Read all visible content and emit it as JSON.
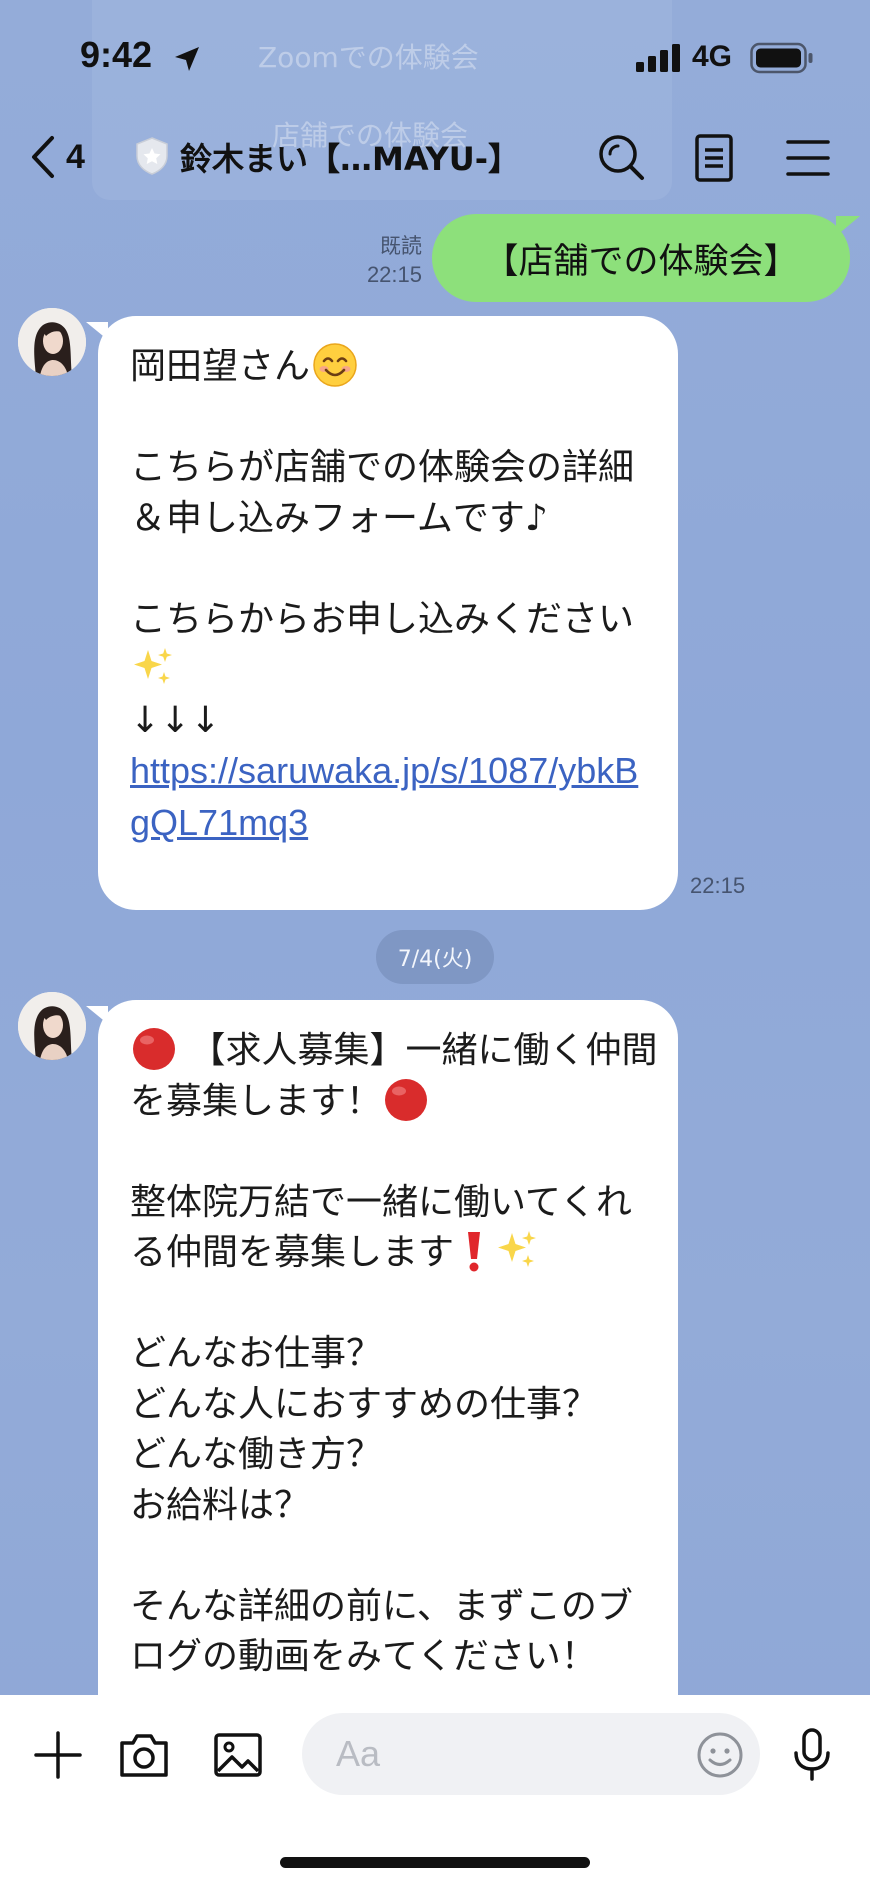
{
  "status_bar": {
    "time": "9:42",
    "network": "4G"
  },
  "ghost_menu": {
    "item1": "Zoomでの体験会",
    "item2": "店舗での体験会"
  },
  "header": {
    "back_count": "4",
    "title": "鈴木まい【…MAYU-】",
    "icons": [
      "chevron-left-icon",
      "shield-icon",
      "search-icon",
      "notes-icon",
      "menu-icon"
    ]
  },
  "messages": {
    "sent1": {
      "text": "【店舗での体験会】",
      "read_label": "既読",
      "time": "22:15"
    },
    "recv1": {
      "line1": "岡田望さん",
      "line1_emoji": "smiling-face-emoji",
      "body1": "\n\nこちらが店舗での体験会の詳細＆申し込みフォームです♪\n\nこちらからお申し込みください",
      "body1_emoji": "sparkles-emoji",
      "arrows": "\n↓↓↓\n",
      "link": "https://saruwaka.jp/s/1087/ybkBgQL71mq3",
      "time": "22:15"
    },
    "date_divider": "7/4(火)",
    "recv2": {
      "part1": " 【求人募集】一緒に働く仲間を募集します！",
      "part2": "\n\n整体院万結で一緒に働いてくれる仲間を募集します",
      "part3": "\n\nどんなお仕事？\nどんな人におすすめの仕事？\nどんな働き方？\nお給料は？\n\nそんな詳細の前に、まずこのブログの動画をみてください！",
      "emojis": [
        "red-circle-emoji",
        "exclamation-emoji",
        "sparkles-emoji"
      ]
    }
  },
  "composer": {
    "placeholder": "Aa",
    "icons": [
      "plus-icon",
      "camera-icon",
      "image-icon",
      "smiley-icon",
      "microphone-icon"
    ]
  },
  "colors": {
    "background": "#8fa8d8",
    "sent_bubble": "#8de07b",
    "received_bubble": "#ffffff",
    "link": "#3b63c2"
  }
}
